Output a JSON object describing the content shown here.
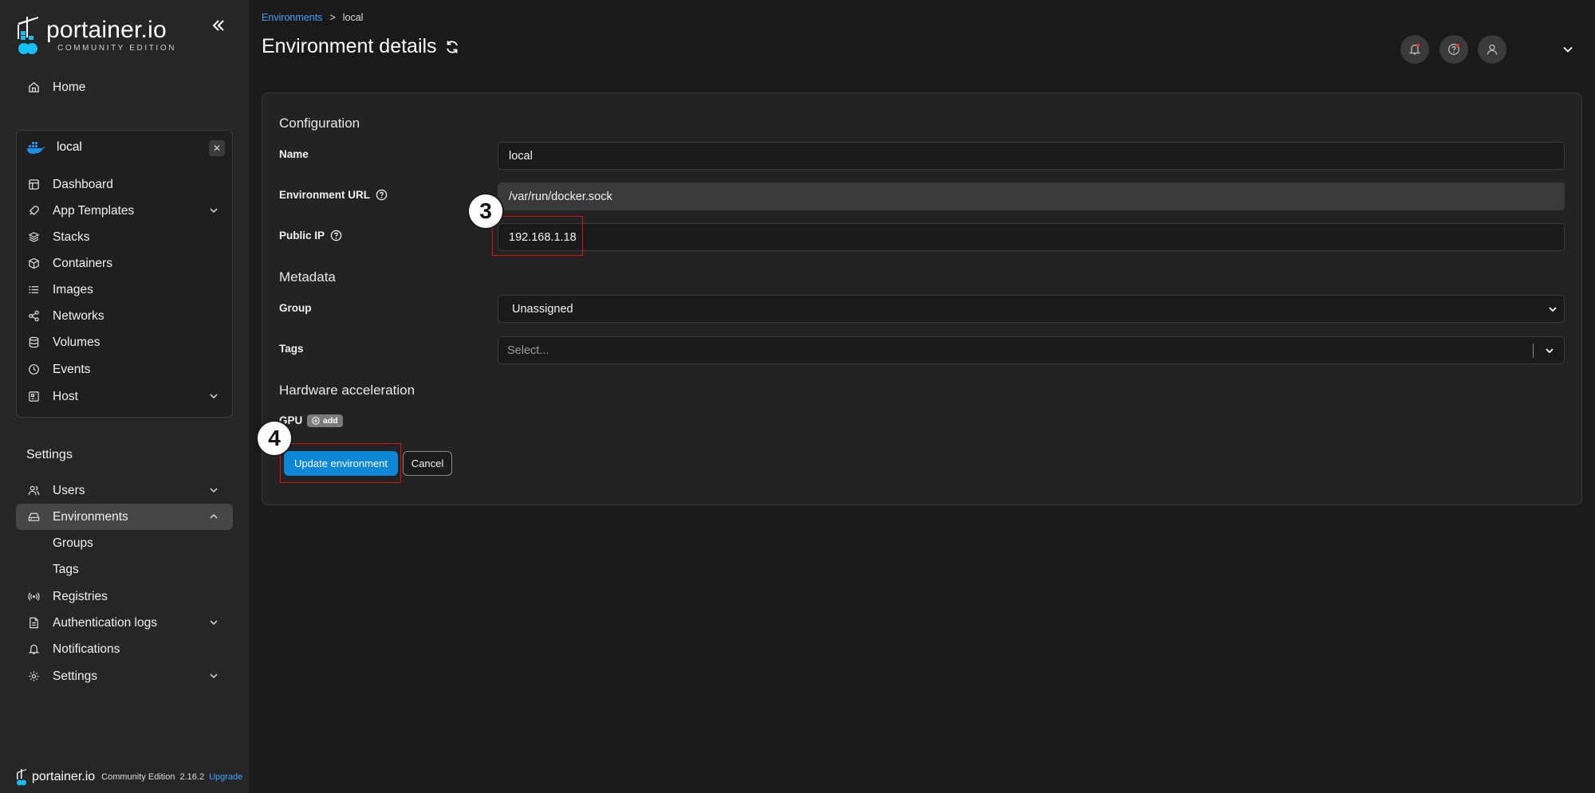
{
  "brand": {
    "name": "portainer.io",
    "edition": "COMMUNITY EDITION"
  },
  "sidebar": {
    "home": "Home",
    "environment": {
      "name": "local",
      "items": [
        {
          "label": "Dashboard",
          "icon": "dashboard-icon"
        },
        {
          "label": "App Templates",
          "icon": "rocket-icon",
          "expandable": true
        },
        {
          "label": "Stacks",
          "icon": "layers-icon"
        },
        {
          "label": "Containers",
          "icon": "box-icon"
        },
        {
          "label": "Images",
          "icon": "list-icon"
        },
        {
          "label": "Networks",
          "icon": "share-icon"
        },
        {
          "label": "Volumes",
          "icon": "database-icon"
        },
        {
          "label": "Events",
          "icon": "clock-icon"
        },
        {
          "label": "Host",
          "icon": "server-icon",
          "expandable": true
        }
      ]
    },
    "settings_title": "Settings",
    "settings_items": [
      {
        "label": "Users",
        "icon": "users-icon",
        "expandable": true
      },
      {
        "label": "Environments",
        "icon": "hdd-icon",
        "expandable": true,
        "active": true
      },
      {
        "label": "Groups",
        "sub": true
      },
      {
        "label": "Tags",
        "sub": true
      },
      {
        "label": "Registries",
        "icon": "radio-icon"
      },
      {
        "label": "Authentication logs",
        "icon": "file-icon",
        "expandable": true
      },
      {
        "label": "Notifications",
        "icon": "bell-icon"
      },
      {
        "label": "Settings",
        "icon": "gear-icon",
        "expandable": true
      }
    ],
    "footer": {
      "name": "portainer.io",
      "edition": "Community Edition",
      "version": "2.16.2",
      "upgrade": "Upgrade"
    }
  },
  "breadcrumb": {
    "parent": "Environments",
    "separator": ">",
    "current": "local"
  },
  "page_title": "Environment details",
  "form": {
    "configuration_title": "Configuration",
    "name_label": "Name",
    "name_value": "local",
    "url_label": "Environment URL",
    "url_value": "/var/run/docker.sock",
    "public_ip_label": "Public IP",
    "public_ip_value": "192.168.1.18",
    "metadata_title": "Metadata",
    "group_label": "Group",
    "group_value": "Unassigned",
    "tags_label": "Tags",
    "tags_placeholder": "Select...",
    "hw_title": "Hardware acceleration",
    "gpu_label": "GPU",
    "gpu_add": "add",
    "update_button": "Update environment",
    "cancel_button": "Cancel"
  },
  "annotations": {
    "step3": "3",
    "step4": "4",
    "highlight_color": "#e01010"
  },
  "colors": {
    "accent": "#0c88d6",
    "link": "#3ea0ff",
    "docker_blue": "#1d91e6"
  }
}
